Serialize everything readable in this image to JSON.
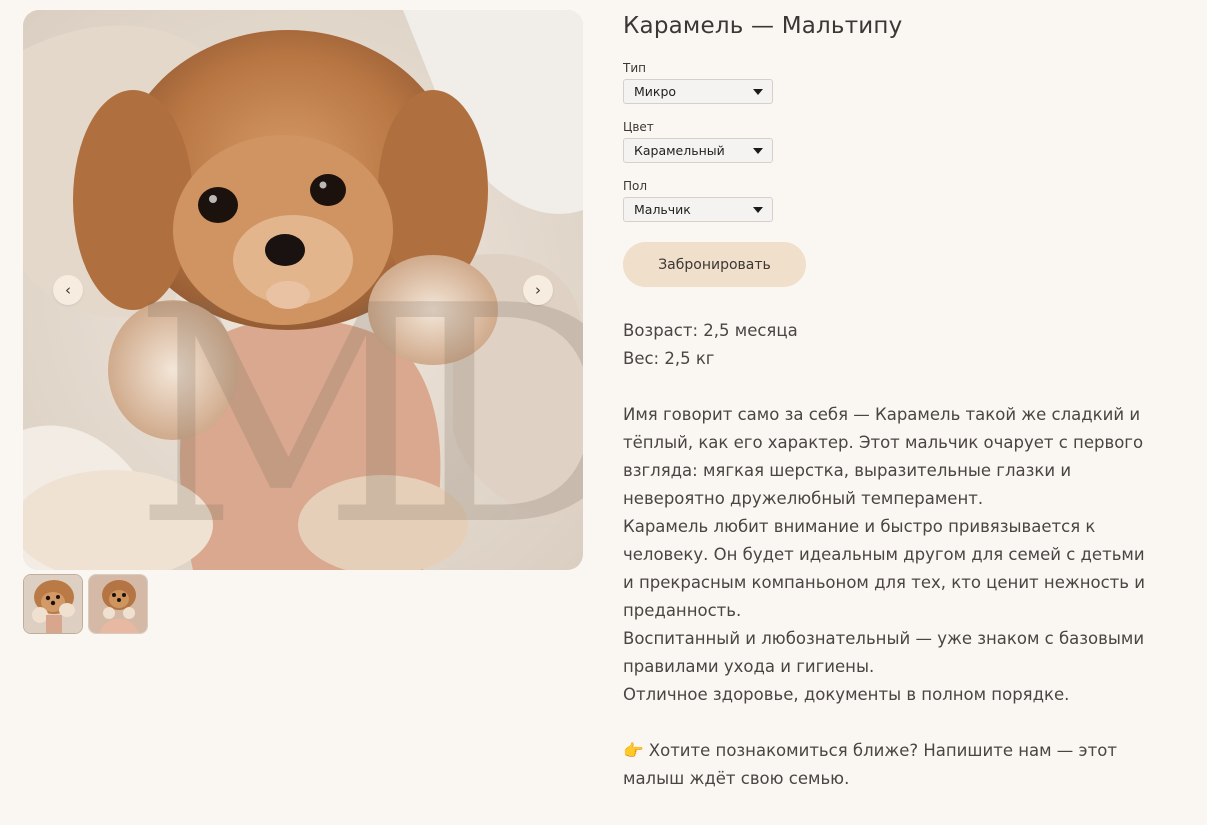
{
  "product": {
    "title": "Карамель — Мальтипу"
  },
  "options": [
    {
      "label": "Тип",
      "value": "Микро"
    },
    {
      "label": "Цвет",
      "value": "Карамельный"
    },
    {
      "label": "Пол",
      "value": "Мальчик"
    }
  ],
  "book_button": "Забронировать",
  "gallery": {
    "prev_icon": "‹",
    "next_icon": "›",
    "watermark": "MD",
    "thumbnail_count": 2
  },
  "details": {
    "age": "Возраст: 2,5 месяца",
    "weight": "Вес: 2,5 кг"
  },
  "description": [
    "Имя говорит само за себя — Карамель такой же сладкий и",
    "тёплый, как его характер. Этот мальчик очарует с первого",
    "взгляда: мягкая шерстка, выразительные глазки и",
    "невероятно дружелюбный темперамент.",
    "Карамель любит внимание и быстро привязывается к",
    "человеку. Он будет идеальным другом для семей с детьми",
    "и прекрасным компаньоном для тех, кто ценит нежность и",
    "преданность.",
    "Воспитанный и любознательный — уже знаком с базовыми",
    "правилами ухода и гигиены.",
    "Отличное здоровье, документы в полном порядке."
  ],
  "cta": [
    "👉 Хотите познакомиться ближе? Напишите нам — этот",
    "малыш ждёт свою семью."
  ],
  "colors": {
    "background": "#faf6f2",
    "button": "#f0dfca",
    "text": "#3b3735"
  }
}
